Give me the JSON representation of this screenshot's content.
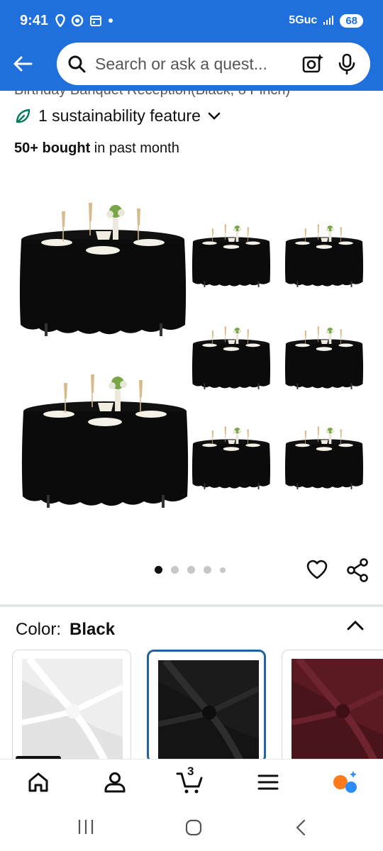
{
  "status_bar": {
    "time": "9:41",
    "network": "5Guc",
    "battery": "68",
    "icons": [
      "location-icon",
      "record-icon",
      "calendar-icon",
      "dot-icon",
      "signal-icon"
    ]
  },
  "header": {
    "search_placeholder": "Search or ask a quest...",
    "icons": [
      "back-arrow-icon",
      "search-icon",
      "camera-sparkle-icon",
      "mic-icon"
    ],
    "accent": "#1f6fdc"
  },
  "product": {
    "title_cutoff": "Birthday Banquet Reception(Black, 8 Pinch)",
    "sustainability_label": "1 sustainability feature",
    "bought_count": "50+ bought",
    "bought_suffix": " in past month"
  },
  "gallery": {
    "dots_total": 5,
    "active_index": 0,
    "table_color": "#0b0b0b"
  },
  "color_selector": {
    "label": "Color:",
    "value": "Black",
    "swatches": [
      {
        "name": "White",
        "color": "#f1f1f1"
      },
      {
        "name": "Black",
        "color": "#1b1b1b"
      },
      {
        "name": "Burgundy",
        "color": "#5b1a22"
      }
    ],
    "selected_index": 1,
    "selection_color": "#2162a1"
  },
  "bottom_nav": {
    "items": [
      "home-icon",
      "account-icon",
      "cart-icon",
      "menu-icon",
      "rufus-icon"
    ],
    "cart_count": "3"
  },
  "system_nav": [
    "recents-icon",
    "home-circle-icon",
    "back-chevron-icon"
  ]
}
